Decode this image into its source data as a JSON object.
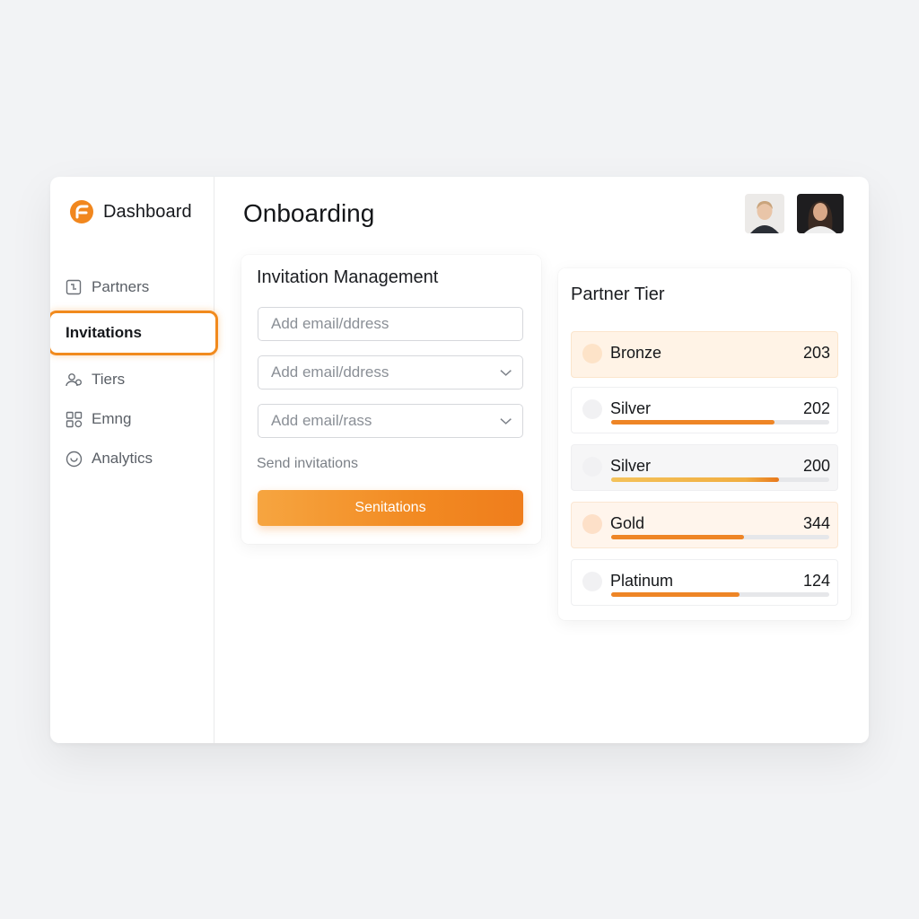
{
  "sidebar": {
    "brand": "Dashboard",
    "items": [
      {
        "label": "Partners",
        "icon": "partners-icon"
      },
      {
        "label": "Invitations",
        "icon": "",
        "active": true
      },
      {
        "label": "Tiers",
        "icon": "users-icon"
      },
      {
        "label": "Emng",
        "icon": "grid-icon"
      },
      {
        "label": "Analytics",
        "icon": "smile-icon"
      }
    ]
  },
  "header": {
    "title": "Onboarding",
    "avatars": [
      "avatar-light",
      "avatar-dark"
    ]
  },
  "invite": {
    "title": "Invitation Management",
    "fields": [
      {
        "placeholder": "Add email/ddress"
      },
      {
        "placeholder": "Add email/ddress"
      },
      {
        "placeholder": "Add email/rass"
      }
    ],
    "helper": "Send invitations",
    "button": "Senitations"
  },
  "tiers": {
    "title": "Partner Tier",
    "rows": [
      {
        "name": "Bronze",
        "count": "203",
        "progress": null
      },
      {
        "name": "Silver",
        "count": "202",
        "progress": 0.75
      },
      {
        "name": "Silver",
        "count": "200",
        "progress": 0.77
      },
      {
        "name": "Gold",
        "count": "344",
        "progress": 0.61
      },
      {
        "name": "Platinum",
        "count": "124",
        "progress": 0.59
      }
    ]
  },
  "colors": {
    "accent": "#f18a1d",
    "accent_light": "#fff3e6"
  }
}
